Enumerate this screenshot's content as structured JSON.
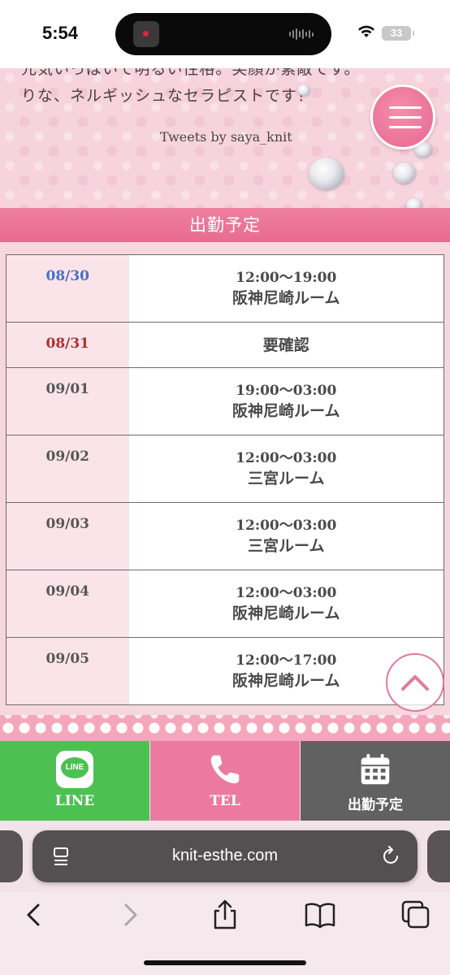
{
  "status_bar": {
    "time": "5:54",
    "battery": "33"
  },
  "hero": {
    "partial_text": "元気いっぱいで明るい性格。笑顔が素敵です。",
    "text": "りな、ネルギッシュなセラピストです！",
    "tweets_link": "Tweets by saya_knit"
  },
  "schedule": {
    "header": "出勤予定",
    "rows": [
      {
        "date": "08/30",
        "time": "12:00〜19:00",
        "room": "阪神尼崎ルーム"
      },
      {
        "date": "08/31",
        "status": "要確認"
      },
      {
        "date": "09/01",
        "time": "19:00〜03:00",
        "room": "阪神尼崎ルーム"
      },
      {
        "date": "09/02",
        "time": "12:00〜03:00",
        "room": "三宮ルーム"
      },
      {
        "date": "09/03",
        "time": "12:00〜03:00",
        "room": "三宮ルーム"
      },
      {
        "date": "09/04",
        "time": "12:00〜03:00",
        "room": "阪神尼崎ルーム"
      },
      {
        "date": "09/05",
        "time": "12:00〜17:00",
        "room": "阪神尼崎ルーム"
      }
    ]
  },
  "bottom_bar": {
    "line_label": "LINE",
    "line_icon_text": "LINE",
    "tel_label": "TEL",
    "schedule_label": "出勤予定"
  },
  "browser": {
    "url": "knit-esthe.com"
  },
  "colors": {
    "pink_accent": "#e86b90",
    "line_green": "#4cc152",
    "tel_pink": "#ec7aa0",
    "schedule_gray": "#616161",
    "saturday_blue": "#4a6fc6",
    "sunday_red": "#b0302e"
  }
}
